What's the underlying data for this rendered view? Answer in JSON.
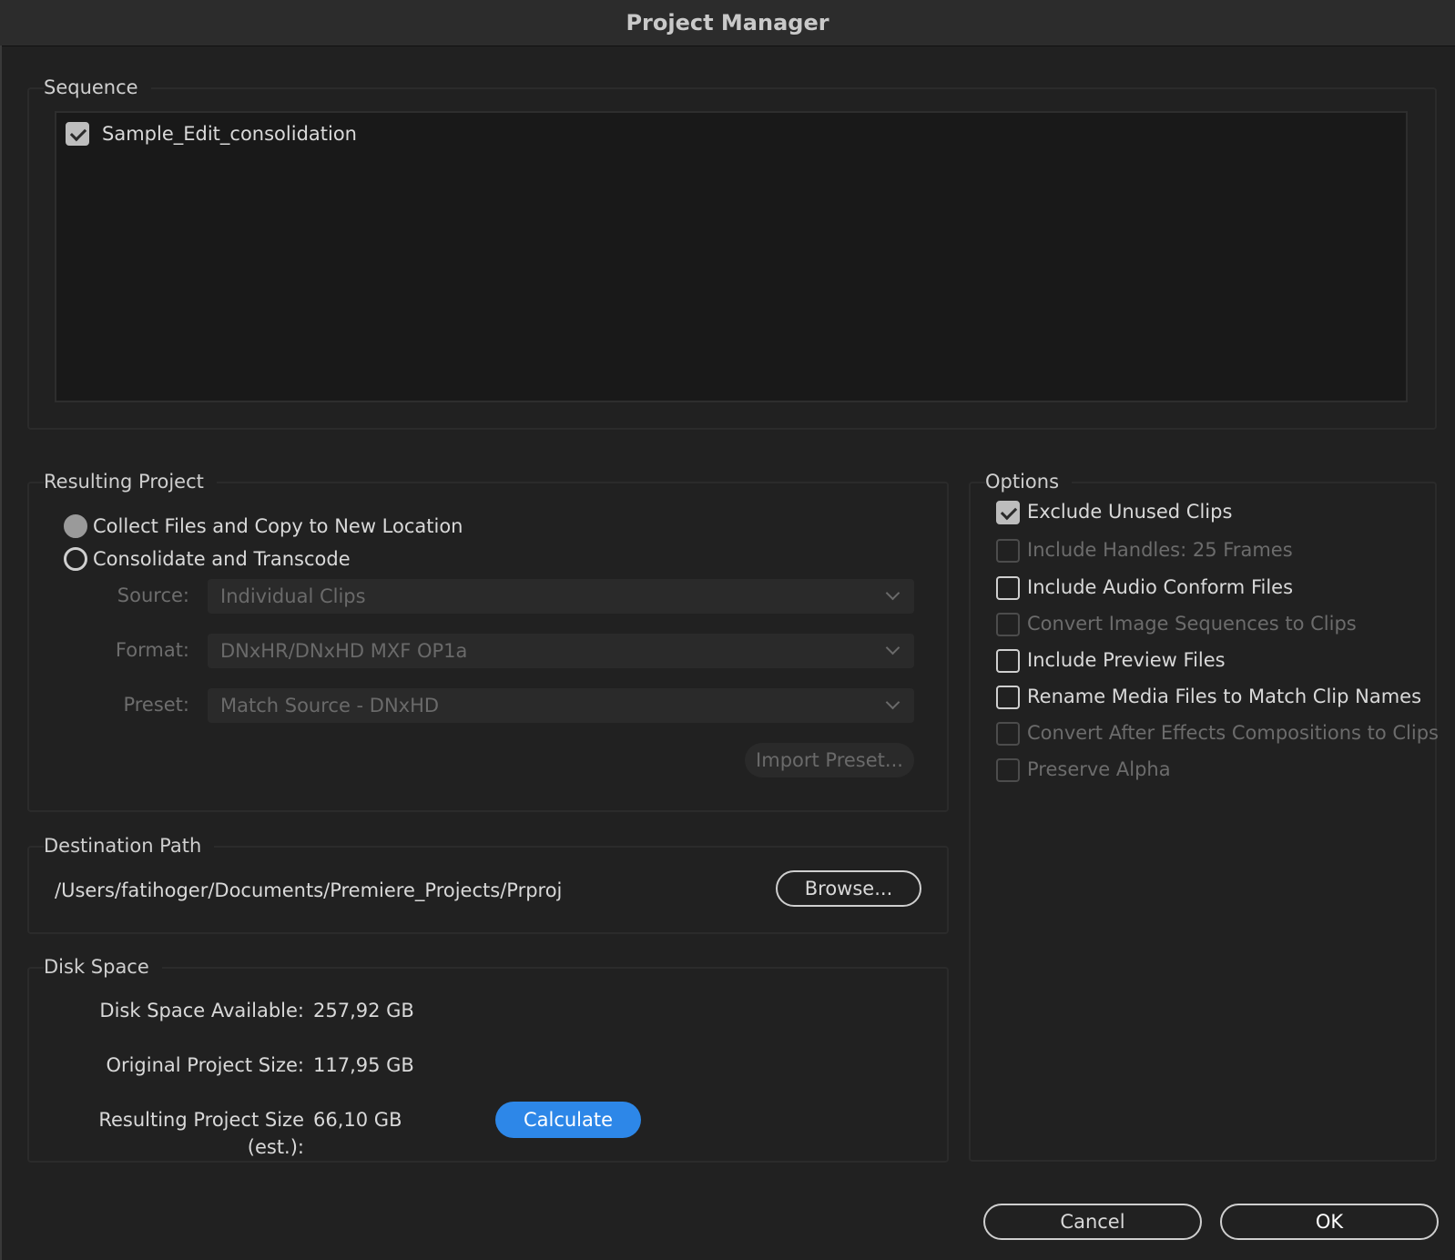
{
  "window": {
    "title": "Project Manager"
  },
  "sequence": {
    "legend": "Sequence",
    "items": [
      {
        "label": "Sample_Edit_consolidation",
        "checked": true
      }
    ]
  },
  "resulting_project": {
    "legend": "Resulting Project",
    "options": [
      {
        "label": "Collect Files and Copy to New Location",
        "selected": true
      },
      {
        "label": "Consolidate and Transcode",
        "selected": false
      }
    ],
    "source": {
      "label": "Source:",
      "value": "Individual Clips"
    },
    "format": {
      "label": "Format:",
      "value": "DNxHR/DNxHD MXF OP1a"
    },
    "preset": {
      "label": "Preset:",
      "value": "Match Source - DNxHD"
    },
    "import_preset_label": "Import Preset..."
  },
  "options": {
    "legend": "Options",
    "items": [
      {
        "label": "Exclude Unused Clips",
        "checked": true,
        "enabled": true
      },
      {
        "label": "Include Handles:  25 Frames",
        "checked": false,
        "enabled": false
      },
      {
        "label": "Include Audio Conform Files",
        "checked": false,
        "enabled": true
      },
      {
        "label": "Convert Image Sequences to Clips",
        "checked": false,
        "enabled": false
      },
      {
        "label": "Include Preview Files",
        "checked": false,
        "enabled": true
      },
      {
        "label": "Rename Media Files to Match Clip Names",
        "checked": false,
        "enabled": true
      },
      {
        "label": "Convert After Effects Compositions to Clips",
        "checked": false,
        "enabled": false
      },
      {
        "label": "Preserve Alpha",
        "checked": false,
        "enabled": false
      }
    ]
  },
  "destination": {
    "legend": "Destination Path",
    "path": "/Users/fatihoger/Documents/Premiere_Projects/Prproj",
    "browse_label": "Browse..."
  },
  "disk_space": {
    "legend": "Disk Space",
    "available_label": "Disk Space Available:",
    "available_value": "257,92 GB",
    "original_label": "Original Project Size:",
    "original_value": "117,95 GB",
    "resulting_label": "Resulting Project Size (est.):",
    "resulting_value": "66,10 GB",
    "calculate_label": "Calculate"
  },
  "footer": {
    "cancel_label": "Cancel",
    "ok_label": "OK"
  },
  "colors": {
    "accent": "#2d87e8",
    "background": "#212121"
  }
}
